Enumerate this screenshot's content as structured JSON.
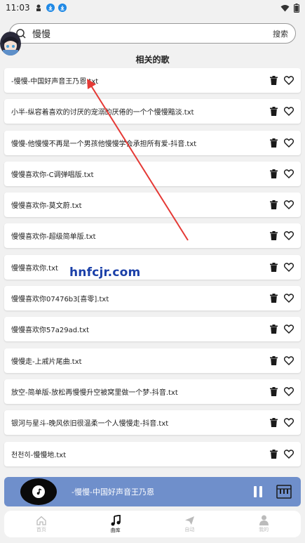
{
  "status_bar": {
    "time": "11:03"
  },
  "search": {
    "value": "慢慢",
    "button_label": "搜索"
  },
  "section_title": "相关的歌",
  "songs": [
    "-慢慢-中国好声音王乃恩.txt",
    "小半-纵容着喜欢的讨厌的宠溺的厌倦的一个个慢慢黯淡.txt",
    "慢慢-他慢慢不再是一个男孩他慢慢学会承担所有爱-抖音.txt",
    "慢慢喜欢你-C调弹唱版.txt",
    "慢慢喜欢你-莫文蔚.txt",
    "慢慢喜欢你-超级简单版.txt",
    "慢慢喜欢你.txt",
    "慢慢喜欢你07476b3[喜零].txt",
    "慢慢喜欢你57a29ad.txt",
    "慢慢走-上戚片尾曲.txt",
    "放空-简单版-放松再慢慢升空被窝里做一个梦-抖音.txt",
    "银河与星斗-晚风依旧很温柔一个人慢慢走-抖音.txt",
    "천천히-慢慢地.txt"
  ],
  "player": {
    "title": "-慢慢-中国好声音王乃恩"
  },
  "nav": [
    {
      "label": "首页",
      "icon": "home-icon"
    },
    {
      "label": "曲库",
      "icon": "music-note-icon"
    },
    {
      "label": "自动",
      "icon": "send-icon"
    },
    {
      "label": "我的",
      "icon": "person-icon"
    }
  ],
  "watermark": "hnfcjr.com",
  "colors": {
    "player_bg": "#6f8fcb",
    "arrow": "#e53935",
    "watermark": "#1a3fa8"
  }
}
